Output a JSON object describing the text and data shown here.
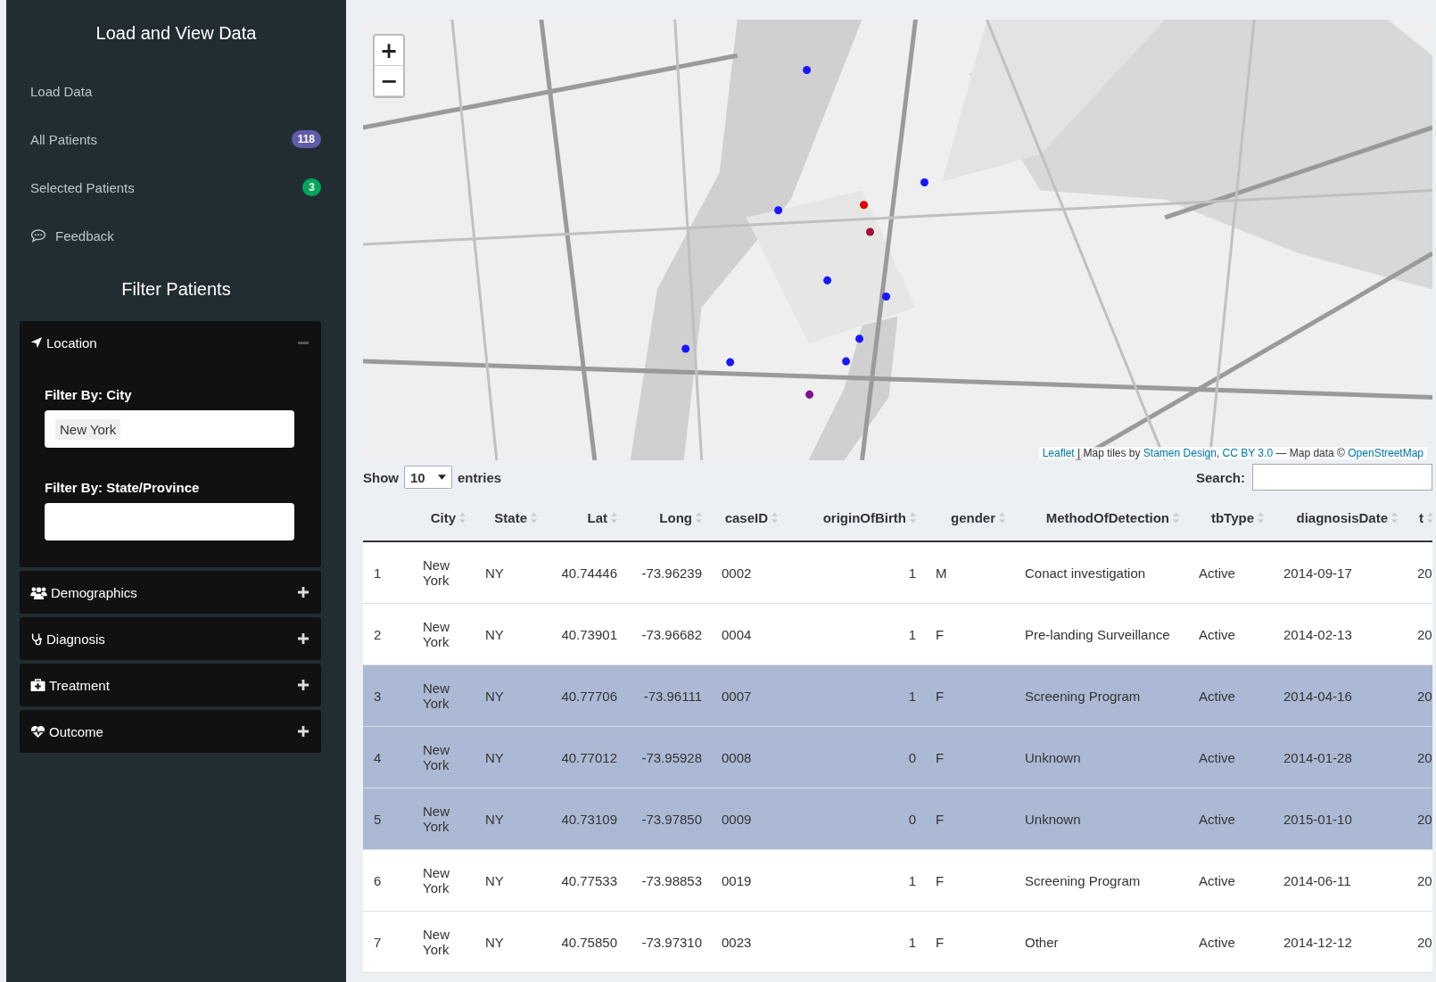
{
  "sidebar": {
    "title": "Load and View Data",
    "menu": [
      {
        "label": "Load Data"
      },
      {
        "label": "All Patients",
        "badge": "118",
        "color": "#605ca8"
      },
      {
        "label": "Selected Patients",
        "badge": "3",
        "color": "#00a65a"
      },
      {
        "label": "Feedback"
      }
    ],
    "filter_title": "Filter Patients",
    "panels": [
      {
        "title": "Location",
        "expanded": true,
        "fields": [
          {
            "label": "Filter By: City",
            "tags": [
              "New York"
            ]
          },
          {
            "label": "Filter By: State/Province"
          }
        ]
      },
      {
        "title": "Demographics",
        "expanded": false
      },
      {
        "title": "Diagnosis",
        "expanded": false
      },
      {
        "title": "Treatment",
        "expanded": false
      },
      {
        "title": "Outcome",
        "expanded": false
      }
    ]
  },
  "map": {
    "zoom_in": "+",
    "zoom_out": "−",
    "attribution": [
      {
        "text": "Leaflet",
        "link": true
      },
      {
        "text": " | Map tiles by ",
        "link": false
      },
      {
        "text": "Stamen Design",
        "link": true
      },
      {
        "text": ", ",
        "link": false
      },
      {
        "text": "CC BY 3.0",
        "link": true
      },
      {
        "text": " — Map data © ",
        "link": false
      },
      {
        "text": "OpenStreetMap",
        "link": true
      }
    ]
  },
  "table_controls": {
    "show_label": "Show",
    "page_size": "10",
    "entries_label": "entries",
    "search_label": "Search:"
  },
  "table": {
    "columns": [
      {
        "kind": "index"
      },
      {
        "label": "City",
        "kind": "text"
      },
      {
        "label": "State",
        "kind": "text"
      },
      {
        "label": "Lat",
        "kind": "number"
      },
      {
        "label": "Long",
        "kind": "number"
      },
      {
        "label": "caseID",
        "kind": "text"
      },
      {
        "label": "originOfBirth",
        "kind": "number"
      },
      {
        "label": "gender",
        "kind": "text"
      },
      {
        "label": "MethodOfDetection",
        "kind": "text"
      },
      {
        "label": "tbType",
        "kind": "text"
      },
      {
        "label": "diagnosisDate",
        "kind": "text"
      },
      {
        "label": "t",
        "kind": "text"
      }
    ],
    "rows": [
      {
        "selected": false,
        "cells": [
          "1",
          "New York",
          "NY",
          "40.74446",
          "-73.96239",
          "0002",
          "1",
          "M",
          "Conact investigation",
          "Active",
          "2014-09-17",
          "20"
        ]
      },
      {
        "selected": false,
        "cells": [
          "2",
          "New York",
          "NY",
          "40.73901",
          "-73.96682",
          "0004",
          "1",
          "F",
          "Pre-landing Surveillance",
          "Active",
          "2014-02-13",
          "20"
        ]
      },
      {
        "selected": true,
        "cells": [
          "3",
          "New York",
          "NY",
          "40.77706",
          "-73.96111",
          "0007",
          "1",
          "F",
          "Screening Program",
          "Active",
          "2014-04-16",
          "20"
        ]
      },
      {
        "selected": true,
        "cells": [
          "4",
          "New York",
          "NY",
          "40.77012",
          "-73.95928",
          "0008",
          "0",
          "F",
          "Unknown",
          "Active",
          "2014-01-28",
          "20"
        ]
      },
      {
        "selected": true,
        "cells": [
          "5",
          "New York",
          "NY",
          "40.73109",
          "-73.97850",
          "0009",
          "0",
          "F",
          "Unknown",
          "Active",
          "2015-01-10",
          "20"
        ]
      },
      {
        "selected": false,
        "cells": [
          "6",
          "New York",
          "NY",
          "40.77533",
          "-73.98853",
          "0019",
          "1",
          "F",
          "Screening Program",
          "Active",
          "2014-06-11",
          "20"
        ]
      },
      {
        "selected": false,
        "cells": [
          "7",
          "New York",
          "NY",
          "40.75850",
          "-73.97310",
          "0023",
          "1",
          "F",
          "Other",
          "Active",
          "2014-12-12",
          "20"
        ]
      }
    ]
  }
}
